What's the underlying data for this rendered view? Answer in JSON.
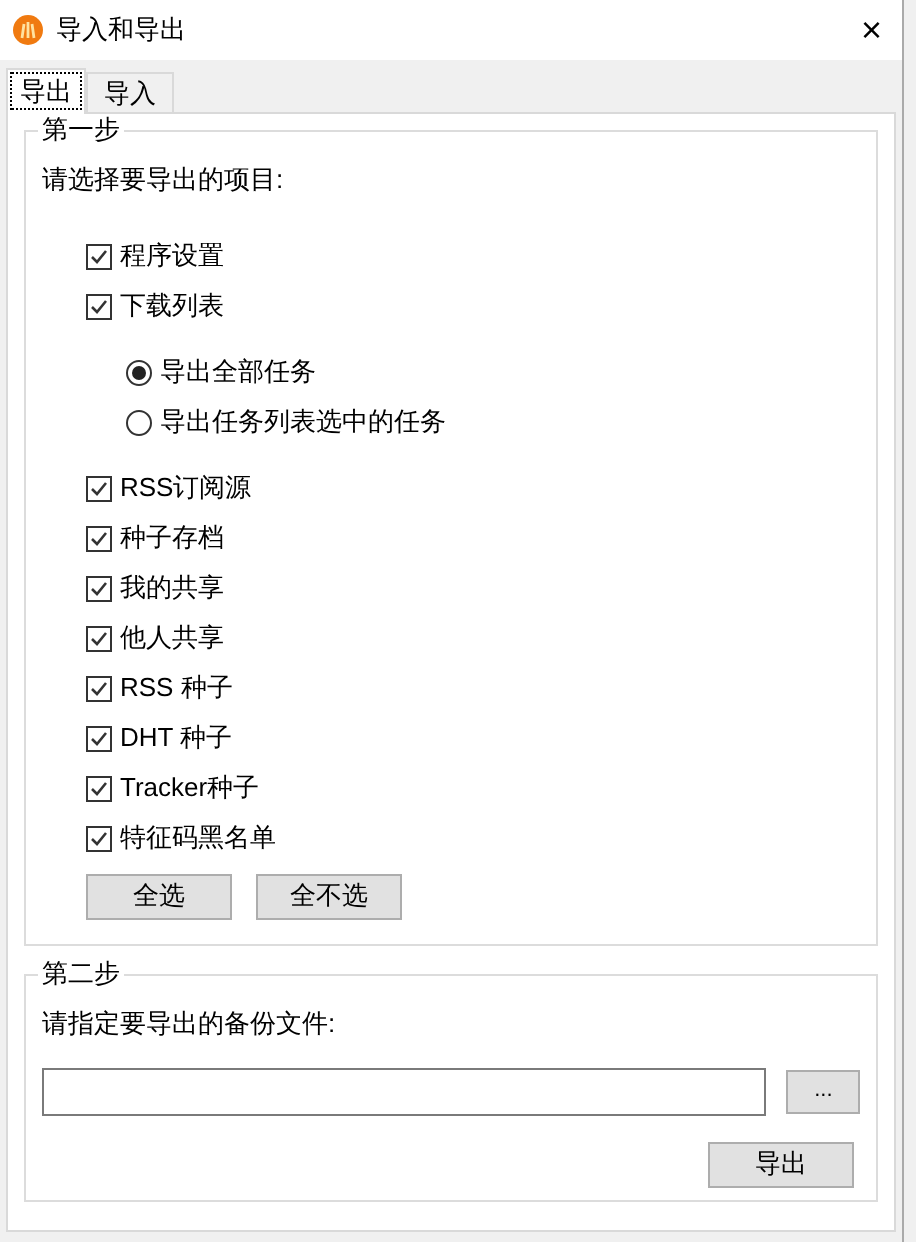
{
  "window": {
    "title": "导入和导出",
    "close": "×"
  },
  "tabs": [
    {
      "label": "导出",
      "selected": true
    },
    {
      "label": "导入",
      "selected": false
    }
  ],
  "step1": {
    "title": "第一步",
    "prompt": "请选择要导出的项目:",
    "items": [
      {
        "label": "程序设置",
        "checked": true
      },
      {
        "label": "下载列表",
        "checked": true,
        "options": [
          {
            "label": "导出全部任务",
            "selected": true
          },
          {
            "label": "导出任务列表选中的任务",
            "selected": false
          }
        ]
      },
      {
        "label": "RSS订阅源",
        "checked": true
      },
      {
        "label": "种子存档",
        "checked": true
      },
      {
        "label": "我的共享",
        "checked": true
      },
      {
        "label": "他人共享",
        "checked": true
      },
      {
        "label": "RSS 种子",
        "checked": true
      },
      {
        "label": "DHT 种子",
        "checked": true
      },
      {
        "label": "Tracker种子",
        "checked": true
      },
      {
        "label": "特征码黑名单",
        "checked": true
      }
    ],
    "buttons": [
      "全选",
      "全不选"
    ]
  },
  "step2": {
    "title": "第二步",
    "prompt": "请指定要导出的备份文件:",
    "browse": "...",
    "action": "导出"
  }
}
